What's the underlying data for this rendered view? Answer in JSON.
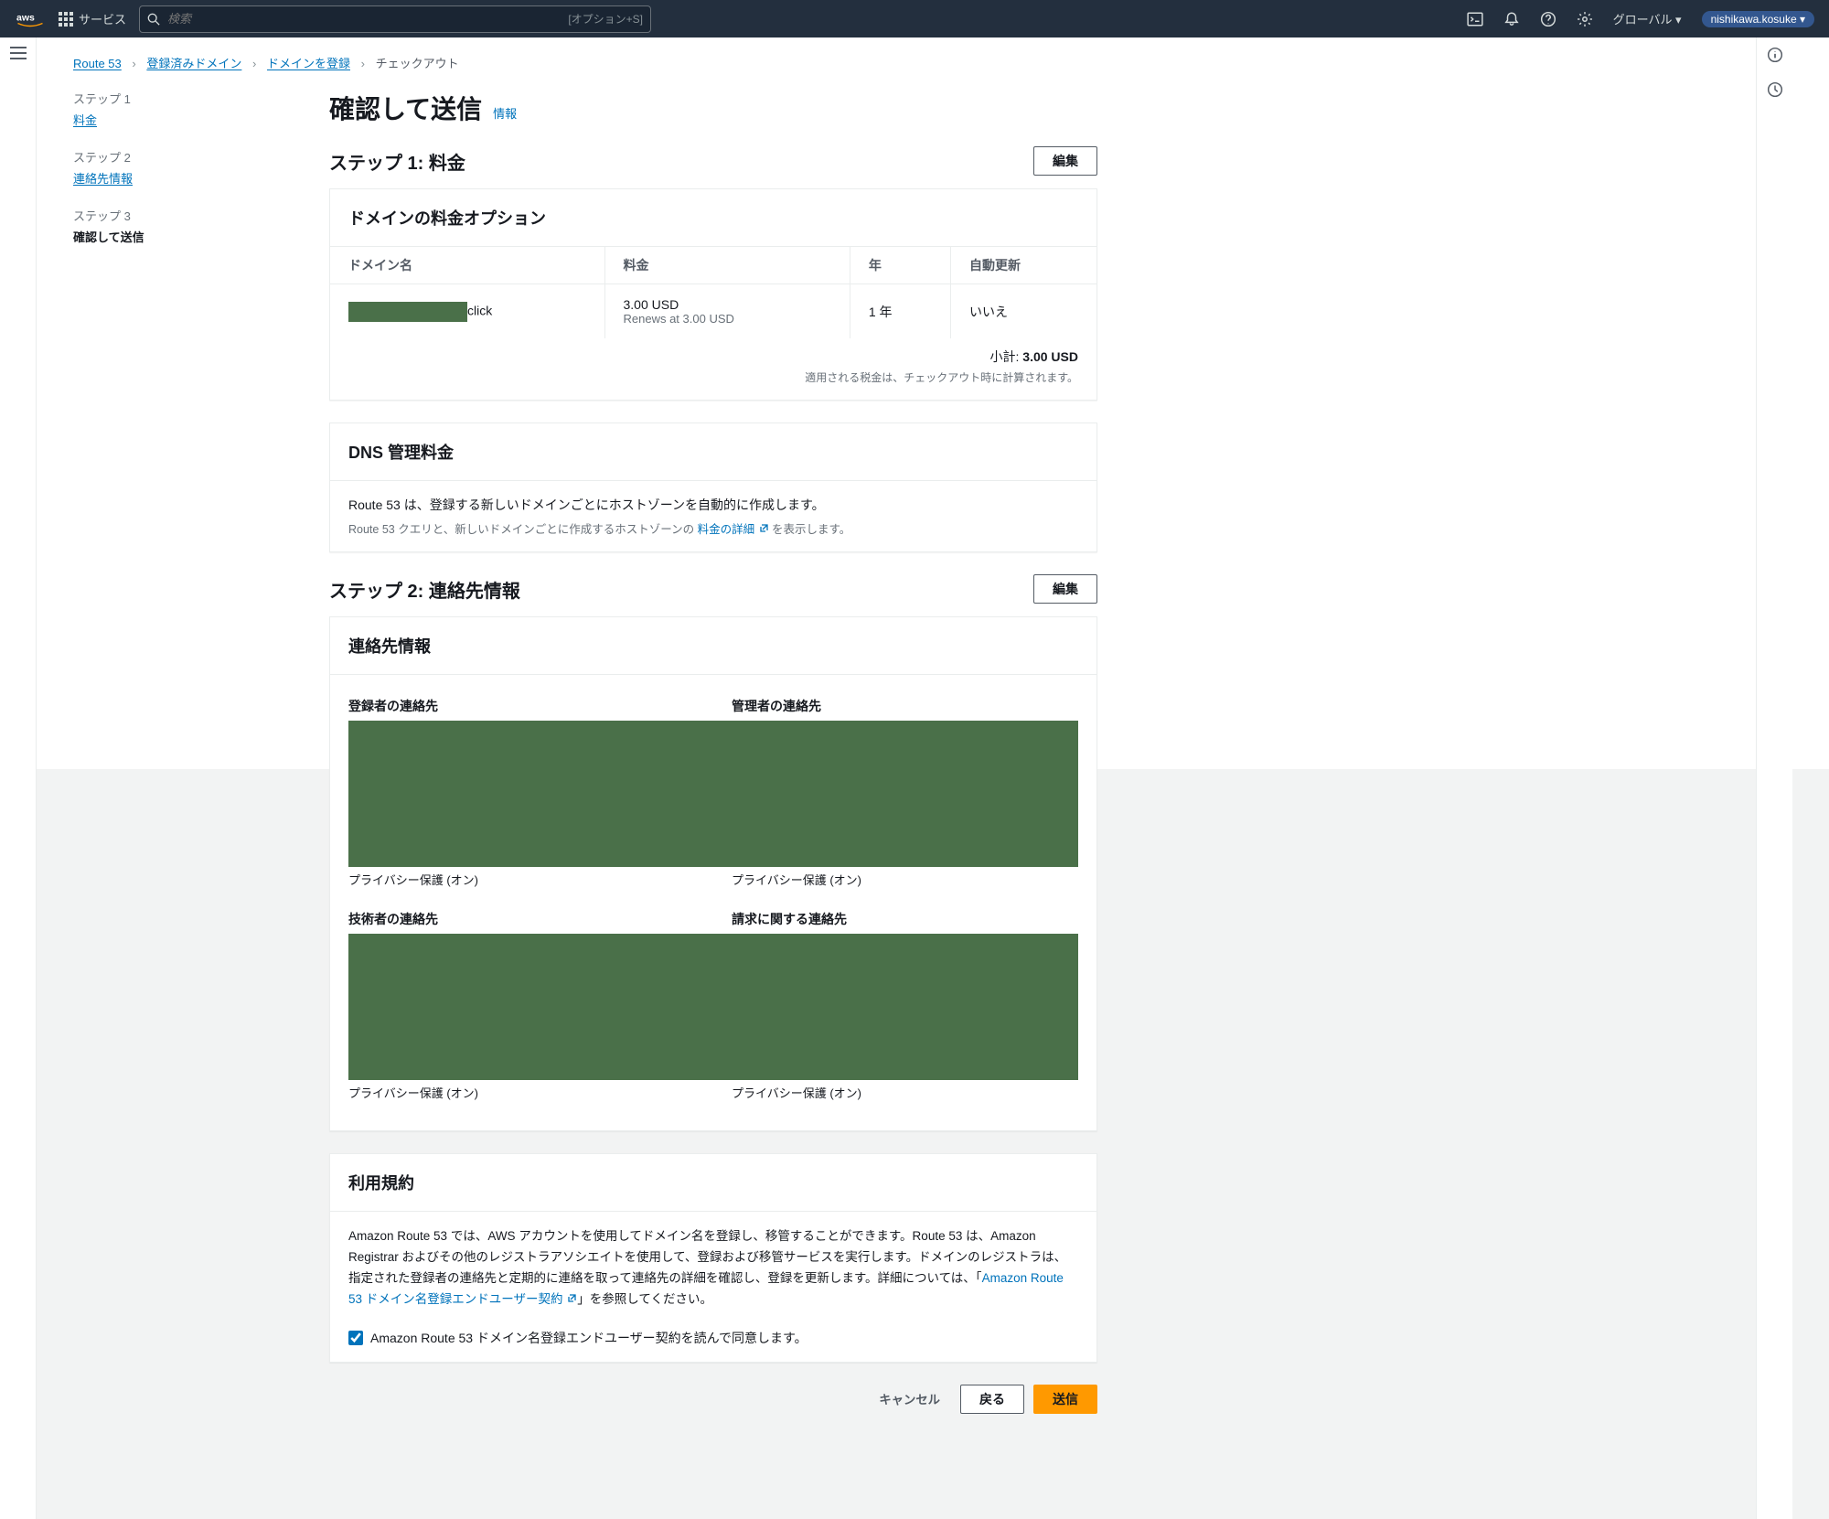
{
  "topbar": {
    "services_label": "サービス",
    "search_placeholder": "検索",
    "search_hint": "[オプション+S]",
    "region": "グローバル ▾",
    "user": "nishikawa.kosuke ▾"
  },
  "breadcrumb": {
    "root": "Route 53",
    "domains": "登録済みドメイン",
    "register": "ドメインを登録",
    "current": "チェックアウト"
  },
  "wizard": {
    "step1_label": "ステップ 1",
    "step1_link": "料金",
    "step2_label": "ステップ 2",
    "step2_link": "連絡先情報",
    "step3_label": "ステップ 3",
    "step3_current": "確認して送信"
  },
  "page": {
    "title": "確認して送信",
    "info": "情報"
  },
  "step1": {
    "heading": "ステップ 1: 料金",
    "edit": "編集",
    "panel_title": "ドメインの料金オプション",
    "th_domain": "ドメイン名",
    "th_price": "料金",
    "th_years": "年",
    "th_auto": "自動更新",
    "domain_suffix": "click",
    "price": "3.00 USD",
    "renews": "Renews at 3.00 USD",
    "years": "1 年",
    "auto": "いいえ",
    "subtotal_label": "小計:",
    "subtotal_value": "3.00 USD",
    "tax_note": "適用される税金は、チェックアウト時に計算されます。"
  },
  "dns": {
    "title": "DNS 管理料金",
    "line1": "Route 53 は、登録する新しいドメインごとにホストゾーンを自動的に作成します。",
    "line2_pre": "Route 53 クエリと、新しいドメインごとに作成するホストゾーンの ",
    "line2_link": "料金の詳細",
    "line2_post": " を表示します。"
  },
  "step2": {
    "heading": "ステップ 2: 連絡先情報",
    "edit": "編集",
    "panel_title": "連絡先情報",
    "registrant": "登録者の連絡先",
    "admin": "管理者の連絡先",
    "tech": "技術者の連絡先",
    "billing": "請求に関する連絡先",
    "privacy": "プライバシー保護 (オン)"
  },
  "terms": {
    "title": "利用規約",
    "body_pre": "Amazon Route 53 では、AWS アカウントを使用してドメイン名を登録し、移管することができます。Route 53 は、Amazon Registrar およびその他のレジストラアソシエイトを使用して、登録および移管サービスを実行します。ドメインのレジストラは、指定された登録者の連絡先と定期的に連絡を取って連絡先の詳細を確認し、登録を更新します。詳細については、「",
    "body_link": "Amazon Route 53 ドメイン名登録エンドユーザー契約",
    "body_post": "」を参照してください。",
    "agree": "Amazon Route 53 ドメイン名登録エンドユーザー契約を読んで同意します。"
  },
  "footer": {
    "cancel": "キャンセル",
    "back": "戻る",
    "submit": "送信"
  }
}
